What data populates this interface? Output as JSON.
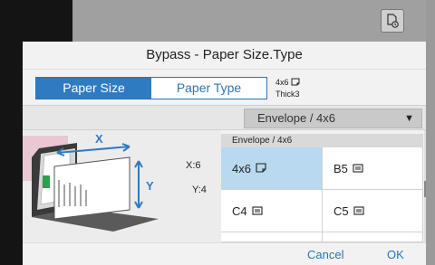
{
  "dialog": {
    "title": "Bypass - Paper Size.Type"
  },
  "tabs": [
    {
      "label": "Paper Size",
      "active": true
    },
    {
      "label": "Paper Type",
      "active": false
    }
  ],
  "current_setting": {
    "size": "4x6",
    "type": "Thick3"
  },
  "select": {
    "value": "Envelope / 4x6"
  },
  "diagram": {
    "x_label": "X",
    "y_label": "Y",
    "x_value": "X:6",
    "y_value": "Y:4"
  },
  "size_list": {
    "header": "Envelope / 4x6",
    "items": [
      {
        "label": "4x6",
        "icon": "portrait-paper-icon",
        "selected": true
      },
      {
        "label": "B5",
        "icon": "landscape-paper-icon",
        "selected": false
      },
      {
        "label": "C4",
        "icon": "landscape-paper-icon",
        "selected": false
      },
      {
        "label": "C5",
        "icon": "landscape-paper-icon",
        "selected": false
      }
    ]
  },
  "footer": {
    "cancel_label": "Cancel",
    "ok_label": "OK"
  },
  "colors": {
    "accent": "#2f7bc1",
    "selected_cell": "#b8d9ef"
  }
}
